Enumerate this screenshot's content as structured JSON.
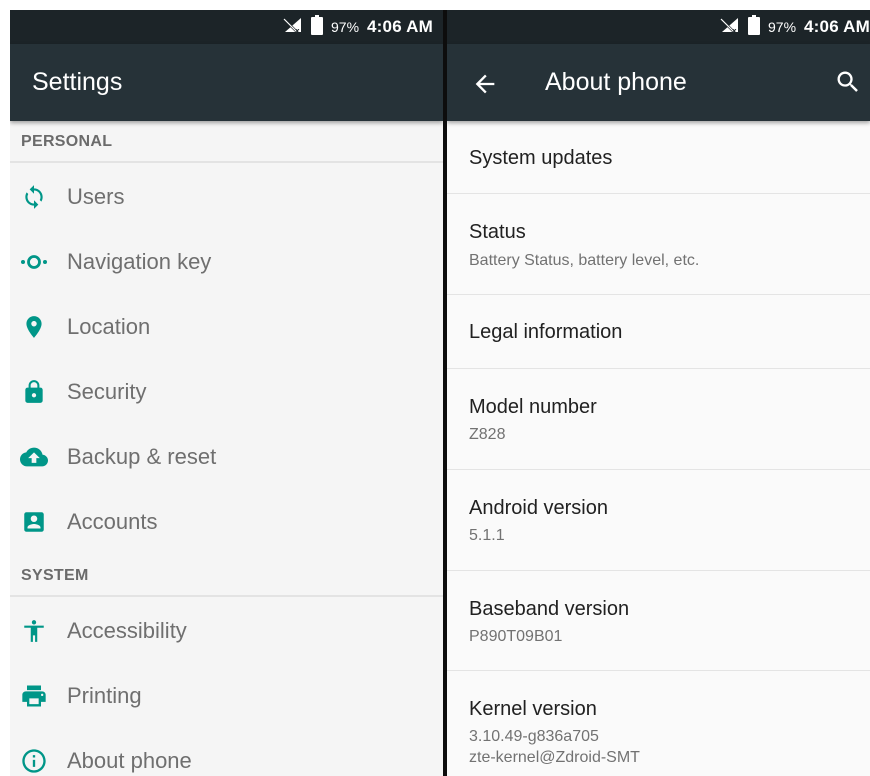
{
  "status_bar": {
    "battery_text": "97%",
    "time": "4:06 AM",
    "icons": [
      "no-sim-icon",
      "battery-icon"
    ]
  },
  "colors": {
    "status_bar": "#1c2428",
    "app_bar": "#263238",
    "accent": "#009688"
  },
  "settings": {
    "title": "Settings",
    "sections": [
      {
        "header": "PERSONAL",
        "items": [
          {
            "label": "Users",
            "icon": "sync-icon"
          },
          {
            "label": "Navigation key",
            "icon": "navigation-key-icon"
          },
          {
            "label": "Location",
            "icon": "location-pin-icon"
          },
          {
            "label": "Security",
            "icon": "lock-icon"
          },
          {
            "label": "Backup & reset",
            "icon": "cloud-upload-icon"
          },
          {
            "label": "Accounts",
            "icon": "account-box-icon"
          }
        ]
      },
      {
        "header": "SYSTEM",
        "items": [
          {
            "label": "Accessibility",
            "icon": "accessibility-icon"
          },
          {
            "label": "Printing",
            "icon": "printer-icon"
          },
          {
            "label": "About phone",
            "icon": "info-icon"
          }
        ]
      }
    ]
  },
  "about": {
    "title": "About phone",
    "back_icon": "arrow-back-icon",
    "search_icon": "search-icon",
    "items": [
      {
        "title": "System updates",
        "summary": ""
      },
      {
        "title": "Status",
        "summary": "Battery Status, battery level, etc."
      },
      {
        "title": "Legal information",
        "summary": ""
      },
      {
        "title": "Model number",
        "summary": "Z828"
      },
      {
        "title": "Android version",
        "summary": "5.1.1"
      },
      {
        "title": "Baseband version",
        "summary": "P890T09B01"
      },
      {
        "title": "Kernel version",
        "summary": "3.10.49-g836a705",
        "summary2": "zte-kernel@Zdroid-SMT"
      }
    ]
  }
}
